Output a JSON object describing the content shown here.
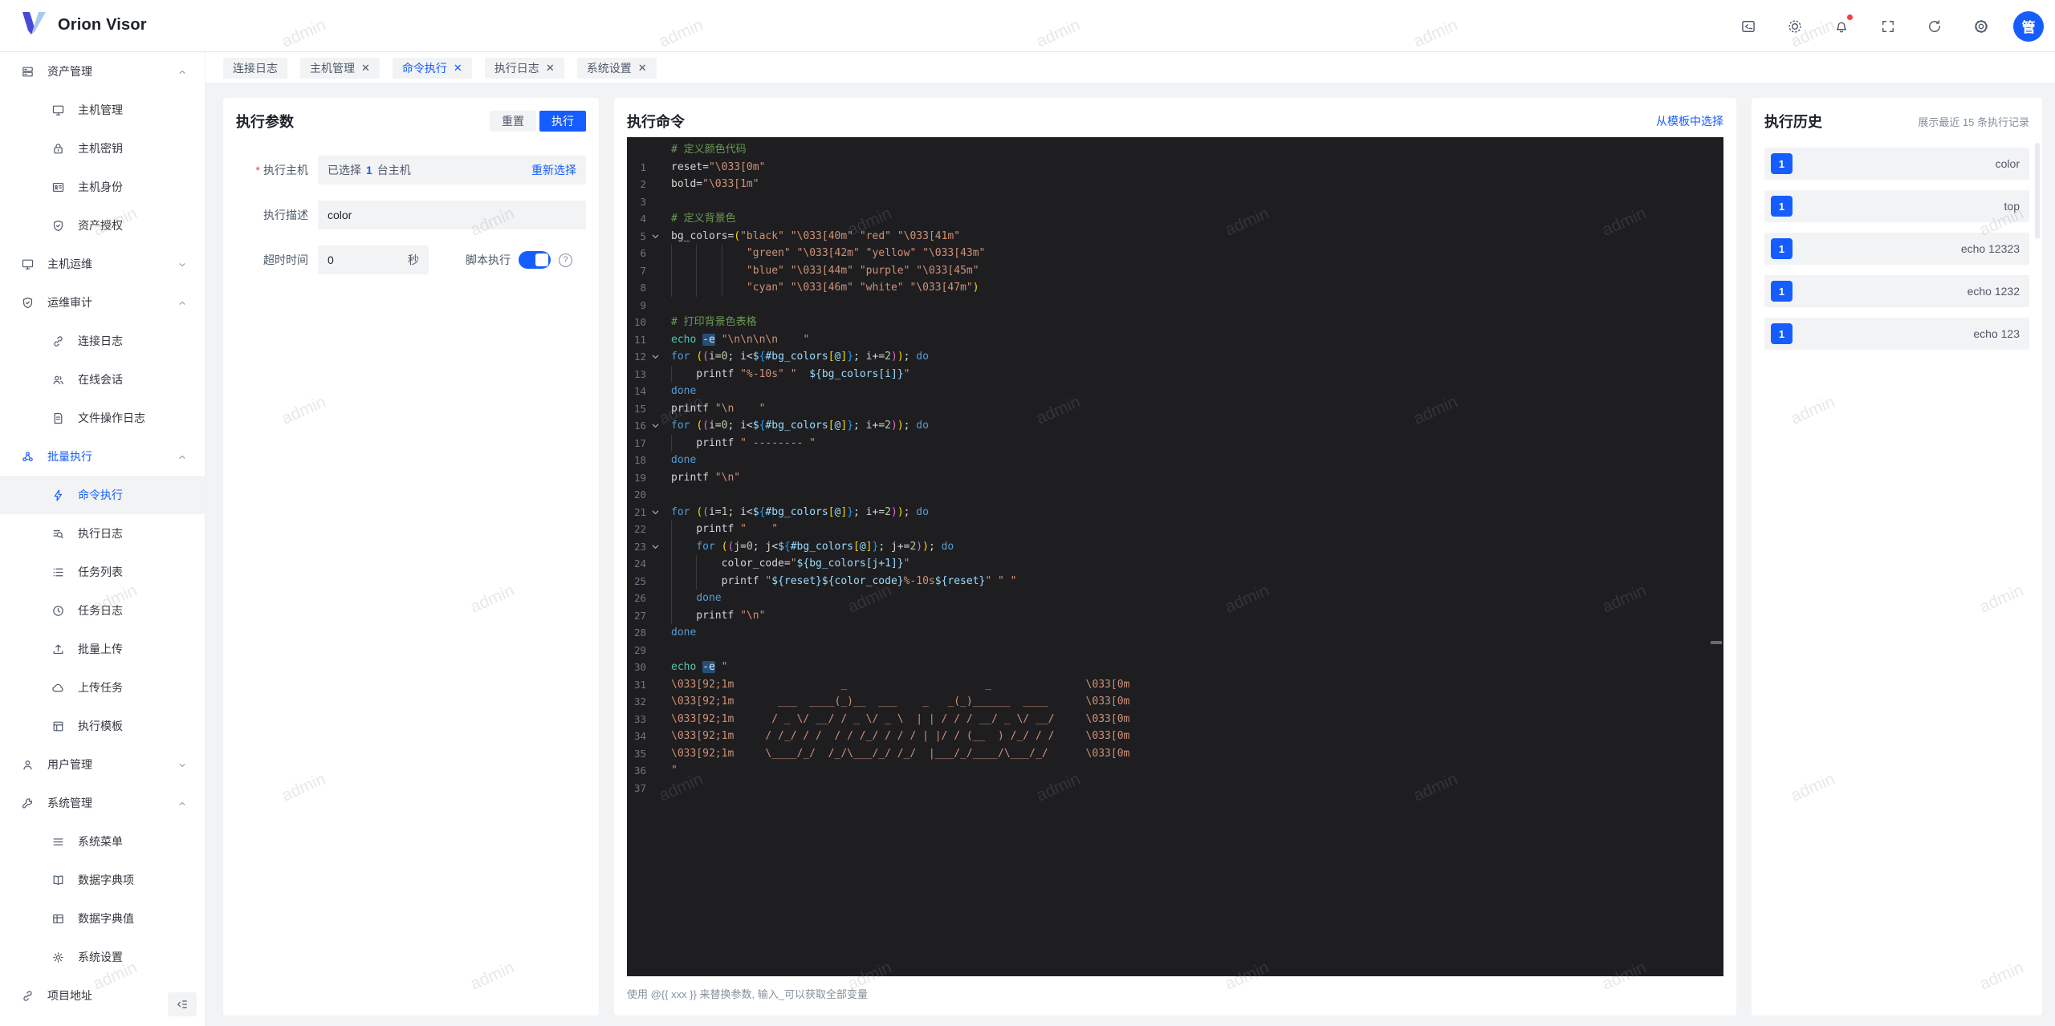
{
  "colors": {
    "accent": "#165dff",
    "danger": "#f53f3f",
    "editor_bg": "#1e1e20",
    "fill": "#f2f3f5"
  },
  "app": {
    "title": "Orion Visor",
    "watermark": "admin",
    "avatar_text": "管"
  },
  "topbar": {
    "icons": [
      {
        "name": "terminal"
      },
      {
        "name": "theme-sun"
      },
      {
        "name": "notifications-bell",
        "dot": true
      },
      {
        "name": "fullscreen"
      },
      {
        "name": "refresh"
      },
      {
        "name": "settings-gear"
      }
    ]
  },
  "tabs": [
    {
      "label": "连接日志",
      "closable": false,
      "active": false
    },
    {
      "label": "主机管理",
      "closable": true,
      "active": false
    },
    {
      "label": "命令执行",
      "closable": true,
      "active": true
    },
    {
      "label": "执行日志",
      "closable": true,
      "active": false
    },
    {
      "label": "系统设置",
      "closable": true,
      "active": false
    }
  ],
  "sidebar": {
    "items": [
      {
        "type": "group",
        "icon": "server",
        "label": "资产管理",
        "expanded": true
      },
      {
        "type": "child",
        "icon": "monitor",
        "label": "主机管理"
      },
      {
        "type": "child",
        "icon": "lock",
        "label": "主机密钥"
      },
      {
        "type": "child",
        "icon": "idcard",
        "label": "主机身份"
      },
      {
        "type": "child",
        "icon": "shield",
        "label": "资产授权"
      },
      {
        "type": "group",
        "icon": "monitor",
        "label": "主机运维",
        "expanded": false
      },
      {
        "type": "group",
        "icon": "shield",
        "label": "运维审计",
        "expanded": true
      },
      {
        "type": "child",
        "icon": "link",
        "label": "连接日志"
      },
      {
        "type": "child",
        "icon": "users",
        "label": "在线会话"
      },
      {
        "type": "child",
        "icon": "file",
        "label": "文件操作日志"
      },
      {
        "type": "group",
        "icon": "cluster",
        "label": "批量执行",
        "expanded": true,
        "blue": true
      },
      {
        "type": "child",
        "icon": "bolt",
        "label": "命令执行",
        "active": true
      },
      {
        "type": "child",
        "icon": "searchlist",
        "label": "执行日志"
      },
      {
        "type": "child",
        "icon": "list",
        "label": "任务列表"
      },
      {
        "type": "child",
        "icon": "clock",
        "label": "任务日志"
      },
      {
        "type": "child",
        "icon": "upload",
        "label": "批量上传"
      },
      {
        "type": "child",
        "icon": "cloud",
        "label": "上传任务"
      },
      {
        "type": "child",
        "icon": "template",
        "label": "执行模板"
      },
      {
        "type": "group",
        "icon": "user",
        "label": "用户管理",
        "expanded": false
      },
      {
        "type": "group",
        "icon": "wrench",
        "label": "系统管理",
        "expanded": true
      },
      {
        "type": "child",
        "icon": "menu",
        "label": "系统菜单"
      },
      {
        "type": "child",
        "icon": "book",
        "label": "数据字典项"
      },
      {
        "type": "child",
        "icon": "table",
        "label": "数据字典值"
      },
      {
        "type": "child",
        "icon": "gear",
        "label": "系统设置"
      },
      {
        "type": "group",
        "icon": "link",
        "label": "项目地址"
      }
    ]
  },
  "exec_params": {
    "title": "执行参数",
    "reset_button": "重置",
    "run_button": "执行",
    "host": {
      "label": "执行主机",
      "required": true,
      "prefix": "已选择",
      "count": "1",
      "suffix": "台主机",
      "action": "重新选择"
    },
    "desc": {
      "label": "执行描述",
      "value": "color"
    },
    "timeout": {
      "label": "超时时间",
      "value": "0",
      "unit": "秒"
    },
    "script": {
      "label": "脚本执行",
      "enabled": true
    }
  },
  "exec_command": {
    "title": "执行命令",
    "template_link": "从模板中选择",
    "hint": "使用 @{{ xxx }} 来替换参数, 输入_可以获取全部变量",
    "code": {
      "fold_lines": [
        6,
        13,
        17,
        22,
        24
      ],
      "lines": [
        [
          [
            "cm",
            "# 定义颜色代码"
          ]
        ],
        [
          [
            "tx",
            "reset="
          ],
          [
            "st",
            "\"\\033[0m\""
          ]
        ],
        [
          [
            "tx",
            "bold="
          ],
          [
            "st",
            "\"\\033[1m\""
          ]
        ],
        [],
        [
          [
            "cm",
            "# 定义背景色"
          ]
        ],
        [
          [
            "tx",
            "bg_colors="
          ],
          [
            "p1",
            "("
          ],
          [
            "st",
            "\"black\""
          ],
          [
            "tx",
            " "
          ],
          [
            "st",
            "\"\\033[40m\""
          ],
          [
            "tx",
            " "
          ],
          [
            "st",
            "\"red\""
          ],
          [
            "tx",
            " "
          ],
          [
            "st",
            "\"\\033[41m\""
          ]
        ],
        [
          [
            "tx",
            "            "
          ],
          [
            "st",
            "\"green\""
          ],
          [
            "tx",
            " "
          ],
          [
            "st",
            "\"\\033[42m\""
          ],
          [
            "tx",
            " "
          ],
          [
            "st",
            "\"yellow\""
          ],
          [
            "tx",
            " "
          ],
          [
            "st",
            "\"\\033[43m\""
          ]
        ],
        [
          [
            "tx",
            "            "
          ],
          [
            "st",
            "\"blue\""
          ],
          [
            "tx",
            " "
          ],
          [
            "st",
            "\"\\033[44m\""
          ],
          [
            "tx",
            " "
          ],
          [
            "st",
            "\"purple\""
          ],
          [
            "tx",
            " "
          ],
          [
            "st",
            "\"\\033[45m\""
          ]
        ],
        [
          [
            "tx",
            "            "
          ],
          [
            "st",
            "\"cyan\""
          ],
          [
            "tx",
            " "
          ],
          [
            "st",
            "\"\\033[46m\""
          ],
          [
            "tx",
            " "
          ],
          [
            "st",
            "\"white\""
          ],
          [
            "tx",
            " "
          ],
          [
            "st",
            "\"\\033[47m\""
          ],
          [
            "p1",
            ")"
          ]
        ],
        [],
        [
          [
            "cm",
            "# 打印背景色表格"
          ]
        ],
        [
          [
            "fn",
            "echo"
          ],
          [
            "tx",
            " "
          ],
          [
            "hl",
            "-e"
          ],
          [
            "tx",
            " "
          ],
          [
            "st",
            "\"\\n\\n\\n\\n    \""
          ]
        ],
        [
          [
            "kw",
            "for"
          ],
          [
            "tx",
            " "
          ],
          [
            "p1",
            "("
          ],
          [
            "p2",
            "("
          ],
          [
            "tx",
            "i="
          ],
          [
            "nu",
            "0"
          ],
          [
            "tx",
            "; i<"
          ],
          [
            "vr",
            "$"
          ],
          [
            "p3",
            "{"
          ],
          [
            "vr",
            "#bg_colors"
          ],
          [
            "p1",
            "["
          ],
          [
            "vr",
            "@"
          ],
          [
            "p1",
            "]"
          ],
          [
            "p3",
            "}"
          ],
          [
            "tx",
            "; i+="
          ],
          [
            "nu",
            "2"
          ],
          [
            "p2",
            ")"
          ],
          [
            "p1",
            ")"
          ],
          [
            "tx",
            "; "
          ],
          [
            "kw",
            "do"
          ]
        ],
        [
          [
            "tx",
            "    printf "
          ],
          [
            "st",
            "\"%-10s\""
          ],
          [
            "tx",
            " "
          ],
          [
            "st",
            "\"  "
          ],
          [
            "vr",
            "${bg_colors[i]}"
          ],
          [
            "st",
            "\""
          ]
        ],
        [
          [
            "kw",
            "done"
          ]
        ],
        [
          [
            "tx",
            "printf "
          ],
          [
            "st",
            "\"\\n    \""
          ]
        ],
        [
          [
            "kw",
            "for"
          ],
          [
            "tx",
            " "
          ],
          [
            "p1",
            "("
          ],
          [
            "p2",
            "("
          ],
          [
            "tx",
            "i="
          ],
          [
            "nu",
            "0"
          ],
          [
            "tx",
            "; i<"
          ],
          [
            "vr",
            "$"
          ],
          [
            "p3",
            "{"
          ],
          [
            "vr",
            "#bg_colors"
          ],
          [
            "p1",
            "["
          ],
          [
            "vr",
            "@"
          ],
          [
            "p1",
            "]"
          ],
          [
            "p3",
            "}"
          ],
          [
            "tx",
            "; i+="
          ],
          [
            "nu",
            "2"
          ],
          [
            "p2",
            ")"
          ],
          [
            "p1",
            ")"
          ],
          [
            "tx",
            "; "
          ],
          [
            "kw",
            "do"
          ]
        ],
        [
          [
            "tx",
            "    printf "
          ],
          [
            "st",
            "\" -------- \""
          ]
        ],
        [
          [
            "kw",
            "done"
          ]
        ],
        [
          [
            "tx",
            "printf "
          ],
          [
            "st",
            "\"\\n\""
          ]
        ],
        [],
        [
          [
            "kw",
            "for"
          ],
          [
            "tx",
            " "
          ],
          [
            "p1",
            "("
          ],
          [
            "p2",
            "("
          ],
          [
            "tx",
            "i="
          ],
          [
            "nu",
            "1"
          ],
          [
            "tx",
            "; i<"
          ],
          [
            "vr",
            "$"
          ],
          [
            "p3",
            "{"
          ],
          [
            "vr",
            "#bg_colors"
          ],
          [
            "p1",
            "["
          ],
          [
            "vr",
            "@"
          ],
          [
            "p1",
            "]"
          ],
          [
            "p3",
            "}"
          ],
          [
            "tx",
            "; i+="
          ],
          [
            "nu",
            "2"
          ],
          [
            "p2",
            ")"
          ],
          [
            "p1",
            ")"
          ],
          [
            "tx",
            "; "
          ],
          [
            "kw",
            "do"
          ]
        ],
        [
          [
            "tx",
            "    printf "
          ],
          [
            "st",
            "\"    \""
          ]
        ],
        [
          [
            "tx",
            "    "
          ],
          [
            "kw",
            "for"
          ],
          [
            "tx",
            " "
          ],
          [
            "p1",
            "("
          ],
          [
            "p2",
            "("
          ],
          [
            "tx",
            "j="
          ],
          [
            "nu",
            "0"
          ],
          [
            "tx",
            "; j<"
          ],
          [
            "vr",
            "$"
          ],
          [
            "p3",
            "{"
          ],
          [
            "vr",
            "#bg_colors"
          ],
          [
            "p1",
            "["
          ],
          [
            "vr",
            "@"
          ],
          [
            "p1",
            "]"
          ],
          [
            "p3",
            "}"
          ],
          [
            "tx",
            "; j+="
          ],
          [
            "nu",
            "2"
          ],
          [
            "p2",
            ")"
          ],
          [
            "p1",
            ")"
          ],
          [
            "tx",
            "; "
          ],
          [
            "kw",
            "do"
          ]
        ],
        [
          [
            "tx",
            "        color_code="
          ],
          [
            "st",
            "\""
          ],
          [
            "vr",
            "${bg_colors[j+1]}"
          ],
          [
            "st",
            "\""
          ]
        ],
        [
          [
            "tx",
            "        printf "
          ],
          [
            "st",
            "\""
          ],
          [
            "vr",
            "${reset}${color_code}"
          ],
          [
            "st",
            "%-10s"
          ],
          [
            "vr",
            "${reset}"
          ],
          [
            "st",
            "\""
          ],
          [
            "tx",
            " "
          ],
          [
            "st",
            "\" \""
          ]
        ],
        [
          [
            "tx",
            "    "
          ],
          [
            "kw",
            "done"
          ]
        ],
        [
          [
            "tx",
            "    printf "
          ],
          [
            "st",
            "\"\\n\""
          ]
        ],
        [
          [
            "kw",
            "done"
          ]
        ],
        [],
        [
          [
            "fn",
            "echo"
          ],
          [
            "tx",
            " "
          ],
          [
            "hl",
            "-e"
          ],
          [
            "tx",
            " "
          ],
          [
            "st",
            "\""
          ]
        ],
        [
          [
            "st",
            "\\033[92;1m                 _                      _               \\033[0m"
          ]
        ],
        [
          [
            "st",
            "\\033[92;1m       ___  ____(_)__  ___    _   _(_)______  ____      \\033[0m"
          ]
        ],
        [
          [
            "st",
            "\\033[92;1m      / _ \\/ __/ / _ \\/ _ \\  | | / / / __/ _ \\/ __/     \\033[0m"
          ]
        ],
        [
          [
            "st",
            "\\033[92;1m     / /_/ / /  / / /_/ / / / | |/ / (__  ) /_/ / /     \\033[0m"
          ]
        ],
        [
          [
            "st",
            "\\033[92;1m     \\____/_/  /_/\\___/_/ /_/  |___/_/____/\\___/_/      \\033[0m"
          ]
        ],
        [
          [
            "st",
            "\""
          ]
        ]
      ]
    }
  },
  "history": {
    "title": "执行历史",
    "subtitle": "展示最近 15 条执行记录",
    "items": [
      {
        "badge": "1",
        "command": "color"
      },
      {
        "badge": "1",
        "command": "top"
      },
      {
        "badge": "1",
        "command": "echo 12323"
      },
      {
        "badge": "1",
        "command": "echo 1232"
      },
      {
        "badge": "1",
        "command": "echo 123"
      }
    ]
  }
}
